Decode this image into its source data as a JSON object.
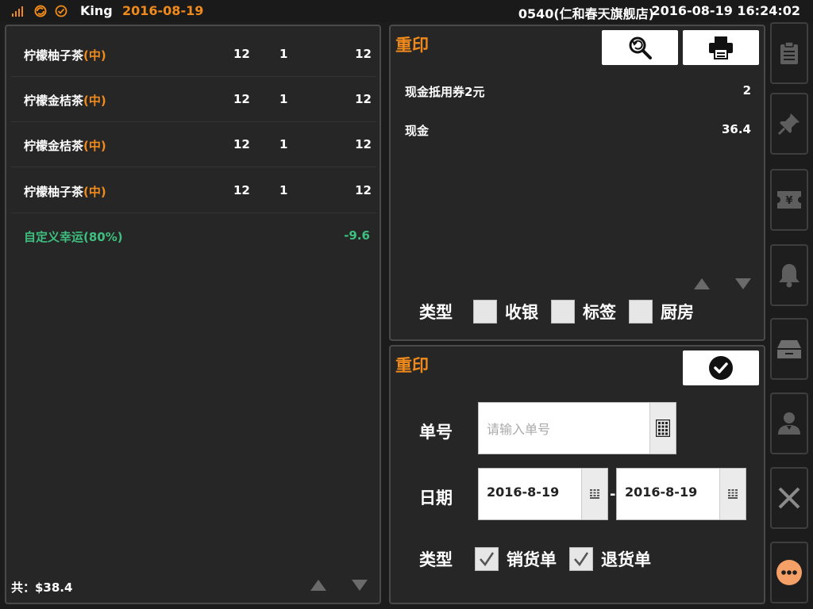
{
  "status_bar": {
    "icons": [
      "signal-icon",
      "cloud-sync-icon",
      "check-circle-icon"
    ],
    "user": "King",
    "date": "2016-08-19",
    "store": "0540(仁和春天旗舰店)",
    "datetime": "2016-08-19 16:24:02"
  },
  "order": {
    "items": [
      {
        "name": "柠檬柚子茶",
        "spec": "(中)",
        "price": "12",
        "qty": "1",
        "total": "12"
      },
      {
        "name": "柠檬金桔茶",
        "spec": "(中)",
        "price": "12",
        "qty": "1",
        "total": "12"
      },
      {
        "name": "柠檬金桔茶",
        "spec": "(中)",
        "price": "12",
        "qty": "1",
        "total": "12"
      },
      {
        "name": "柠檬柚子茶",
        "spec": "(中)",
        "price": "12",
        "qty": "1",
        "total": "12"
      }
    ],
    "discount_label": "自定义幸运(80%)",
    "discount_value": "-9.6",
    "total_label": "共：$38.4"
  },
  "reprint": {
    "title": "重印",
    "payments": [
      {
        "label": "现金抵用券2元",
        "value": "2"
      },
      {
        "label": "现金",
        "value": "36.4"
      }
    ],
    "type_label": "类型",
    "types": [
      "收银",
      "标签",
      "厨房"
    ]
  },
  "search": {
    "title": "重印",
    "order_no_label": "单号",
    "order_no_placeholder": "请输入单号",
    "date_label": "日期",
    "date_from": "2016-8-19",
    "date_to": "2016-8-19",
    "date_sep": "-",
    "type_label": "类型",
    "types": [
      "销货单",
      "退货单"
    ]
  },
  "sidebar": [
    "clipboard-icon",
    "pin-icon",
    "coupon-icon",
    "bell-icon",
    "cash-drawer-icon",
    "user-icon",
    "close-icon",
    "more-icon"
  ],
  "colors": {
    "accent": "#f08a1c",
    "discount": "#3fbf7f",
    "more": "#f4a066"
  }
}
